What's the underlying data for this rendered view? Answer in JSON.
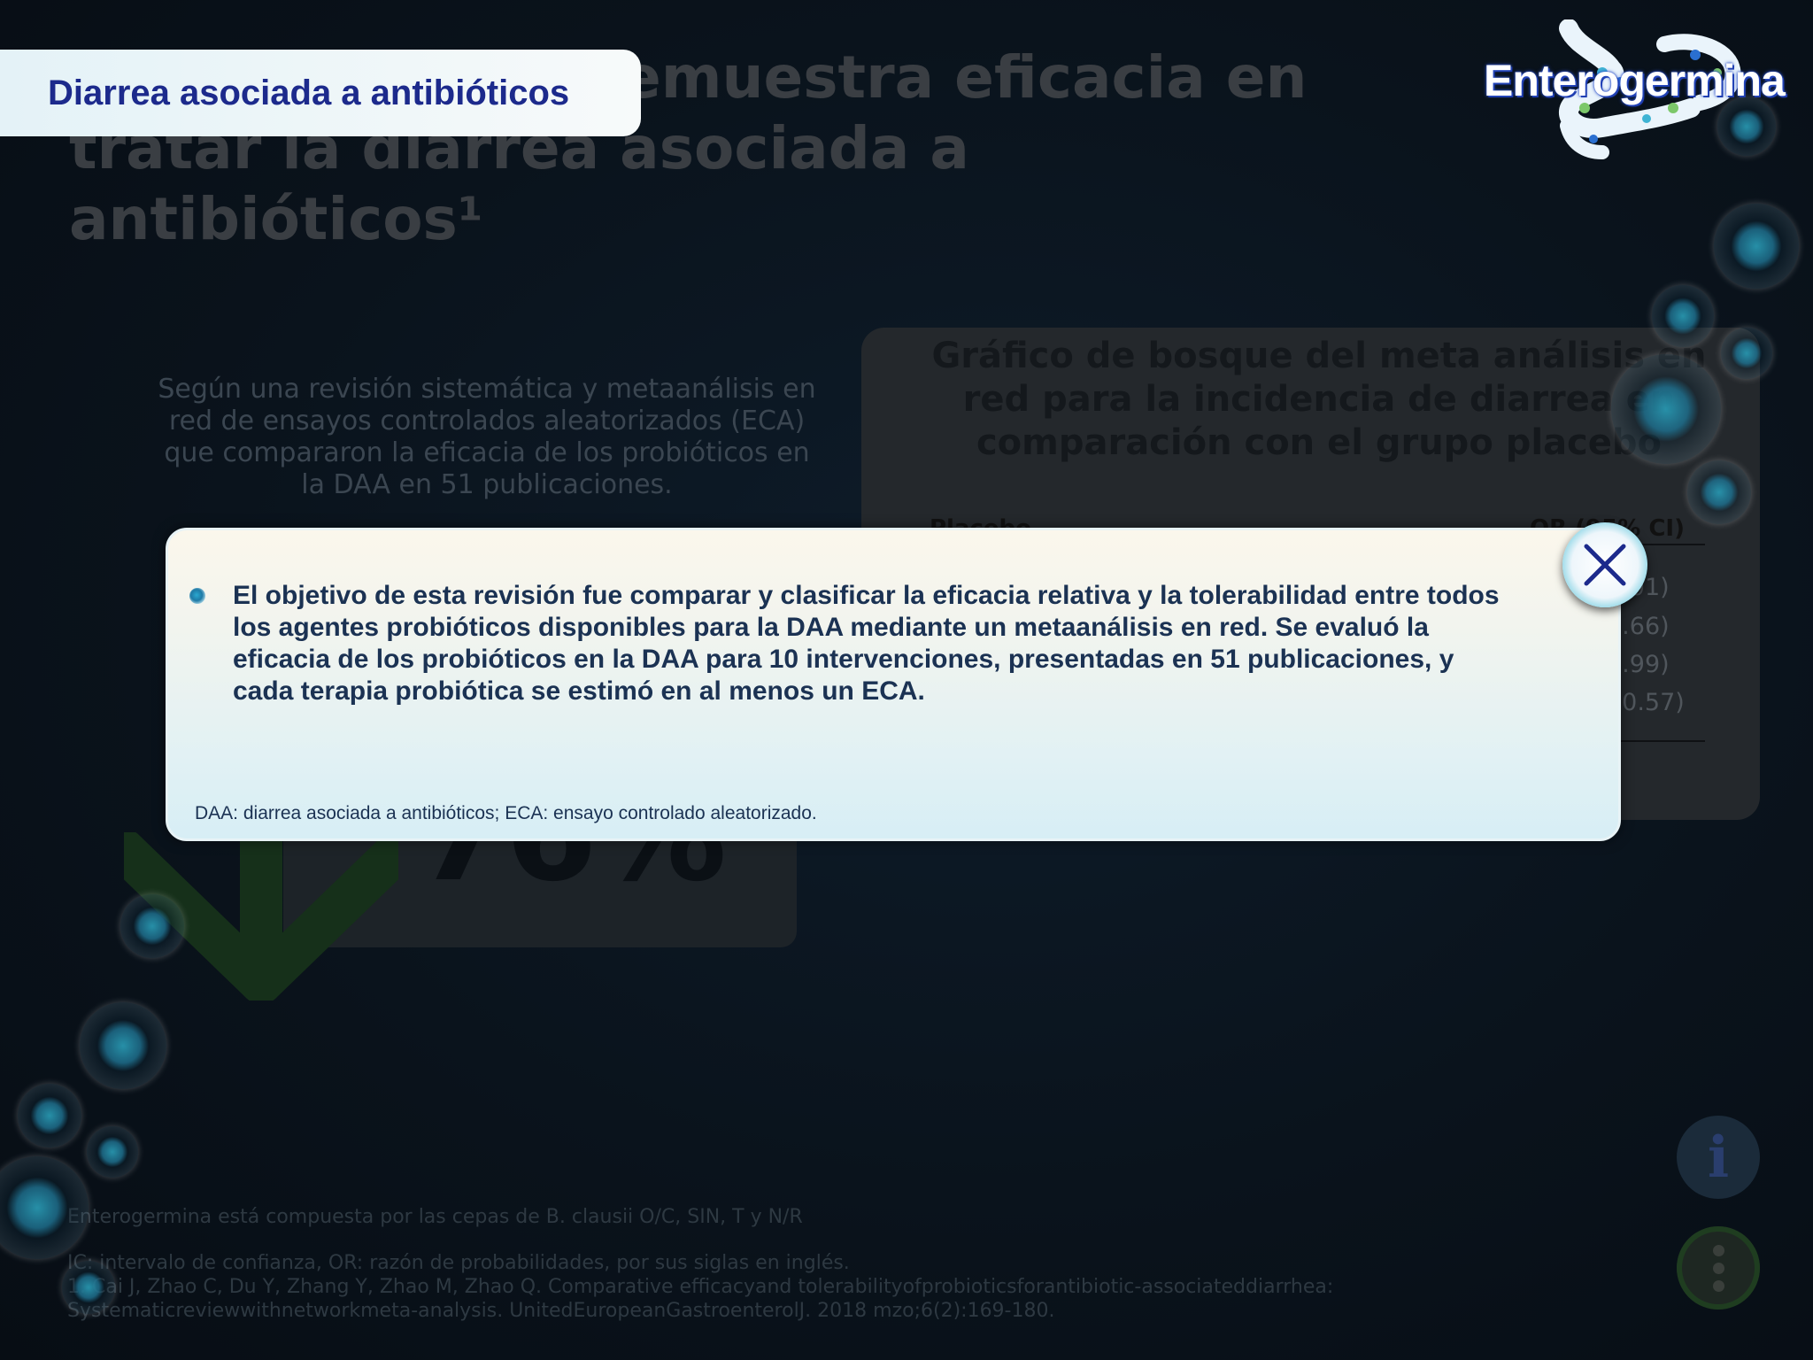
{
  "background": {
    "title": "Enterogermina demuestra eficacia en tratar la diarrea asociada a antibióticos¹",
    "intro": "Según una revisión sistemática y metaanálisis en red de ensayos controlados aleatorizados (ECA) que compararon la eficacia de los probióticos en la DAA en 51 publicaciones.",
    "stat_value": "76%",
    "chart_title": "Gráfico de bosque del meta análisis en red para la incidencia de diarrea en comparación con el grupo placebo",
    "chart_col_left": "Placebo",
    "chart_col_right": "OR (95% CI)",
    "ci_values": [
      "1.01)",
      "2.66)",
      "0.99)",
      ", 0.57)"
    ],
    "footnote_composition": "Enterogermina está compuesta por las cepas de B. clausii O/C, SIN, T y N/R",
    "footnote_abbrev": "IC: intervalo de confianza, OR: razón de probabilidades, por sus siglas en inglés.",
    "footnote_ref_1": "1. Cai J, Zhao C, Du Y, Zhang Y, Zhao M, Zhao Q. Comparative efficacyand tolerabilityofprobioticsforantibiotic-associateddiarrhea:",
    "footnote_ref_2": "Systematicreviewwithnetworkmeta-analysis. UnitedEuropeanGastroenterolJ. 2018 mzo;6(2):169-180."
  },
  "header": {
    "section_label": "Diarrea asociada a antibióticos",
    "logo_text": "Enterogermina"
  },
  "modal": {
    "body": "El objetivo de esta revisión fue comparar y clasificar la eficacia relativa y la tolerabilidad entre todos los agentes probióticos disponibles para la DAA mediante un metaanálisis en red. Se evaluó la eficacia de los probióticos en la DAA para 10 intervenciones, presentadas en 51 publicaciones, y cada terapia probiótica se estimó en al menos un ECA.",
    "footnote": "DAA: diarrea asociada a antibióticos; ECA: ensayo controlado aleatorizado.",
    "close_icon": "close-icon"
  },
  "controls": {
    "info_label": "i",
    "info_icon": "info-icon",
    "menu_icon": "more-vertical-icon"
  },
  "colors": {
    "accent": "#1c2a8c",
    "modal_text": "#1b3253",
    "close_ring": "#2a95b8"
  }
}
